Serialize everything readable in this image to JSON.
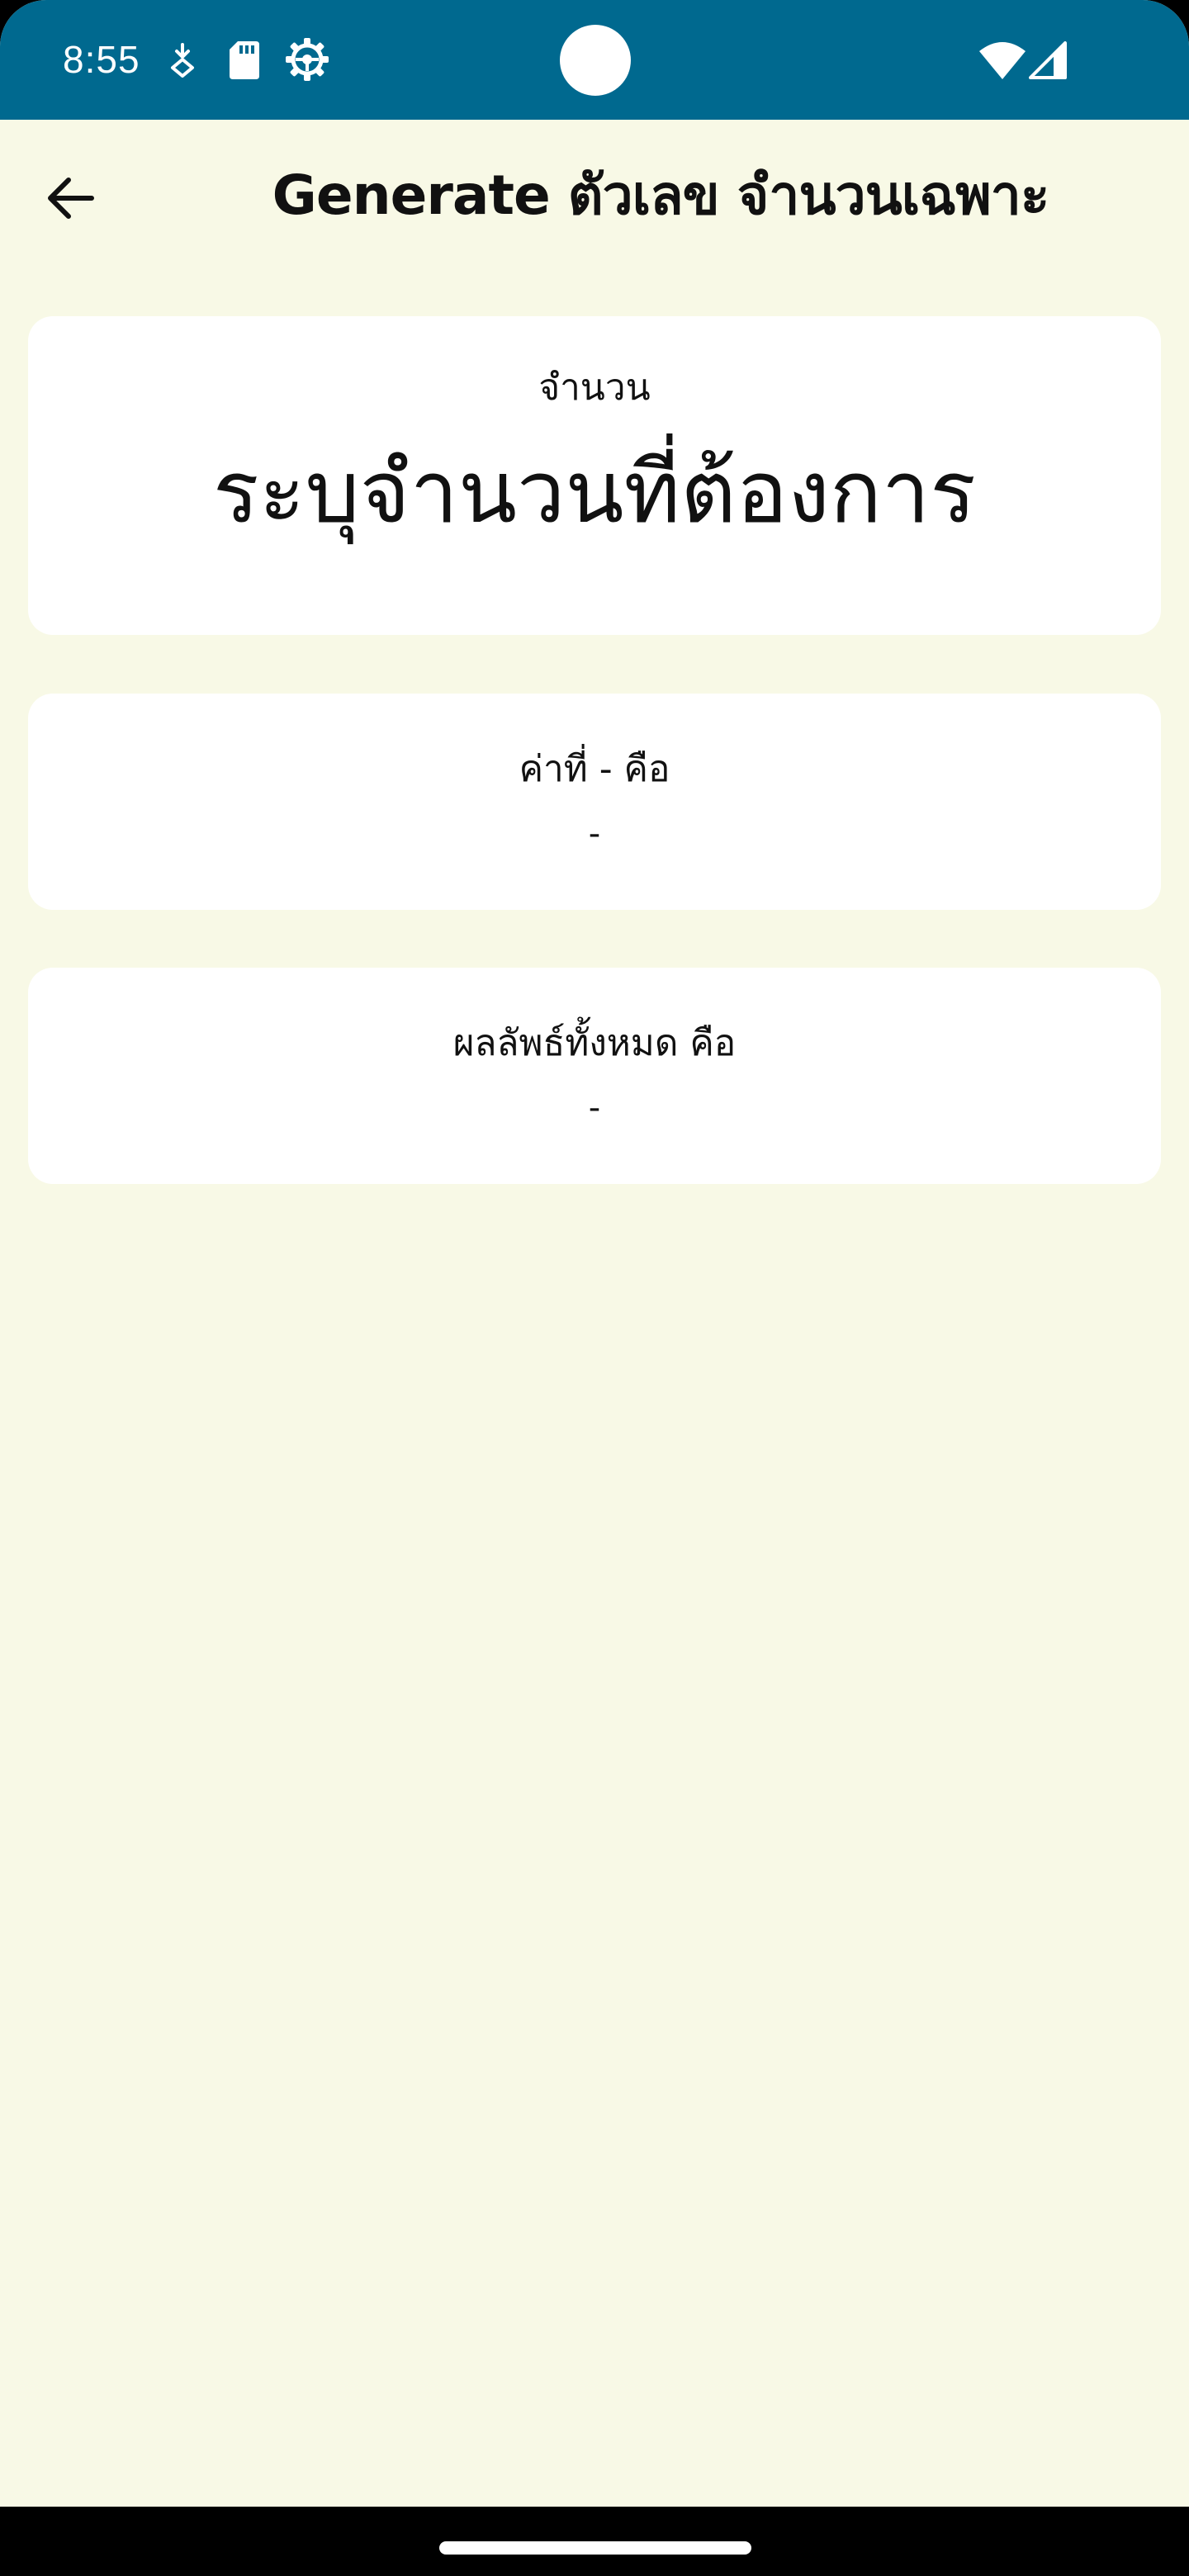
{
  "status_bar": {
    "time": "8:55",
    "background_color": "#00698f",
    "icons": [
      "download-status-icon",
      "sd-card-icon",
      "gear-icon",
      "wifi-icon",
      "signal-icon"
    ]
  },
  "app_bar": {
    "back_icon": "arrow-back-icon",
    "title": "Generate ตัวเลข จำนวนเฉพาะ"
  },
  "amount_card": {
    "label": "จำนวน",
    "placeholder": "ระบุจำนวนที่ต้องการ"
  },
  "value_card": {
    "label": "ค่าที่ - คือ",
    "result": "-"
  },
  "total_card": {
    "label": "ผลลัพธ์ทั้งหมด คือ",
    "result": "-"
  },
  "colors": {
    "page_background": "#f8f9e6",
    "card_background": "#ffffff",
    "text": "#111111"
  }
}
